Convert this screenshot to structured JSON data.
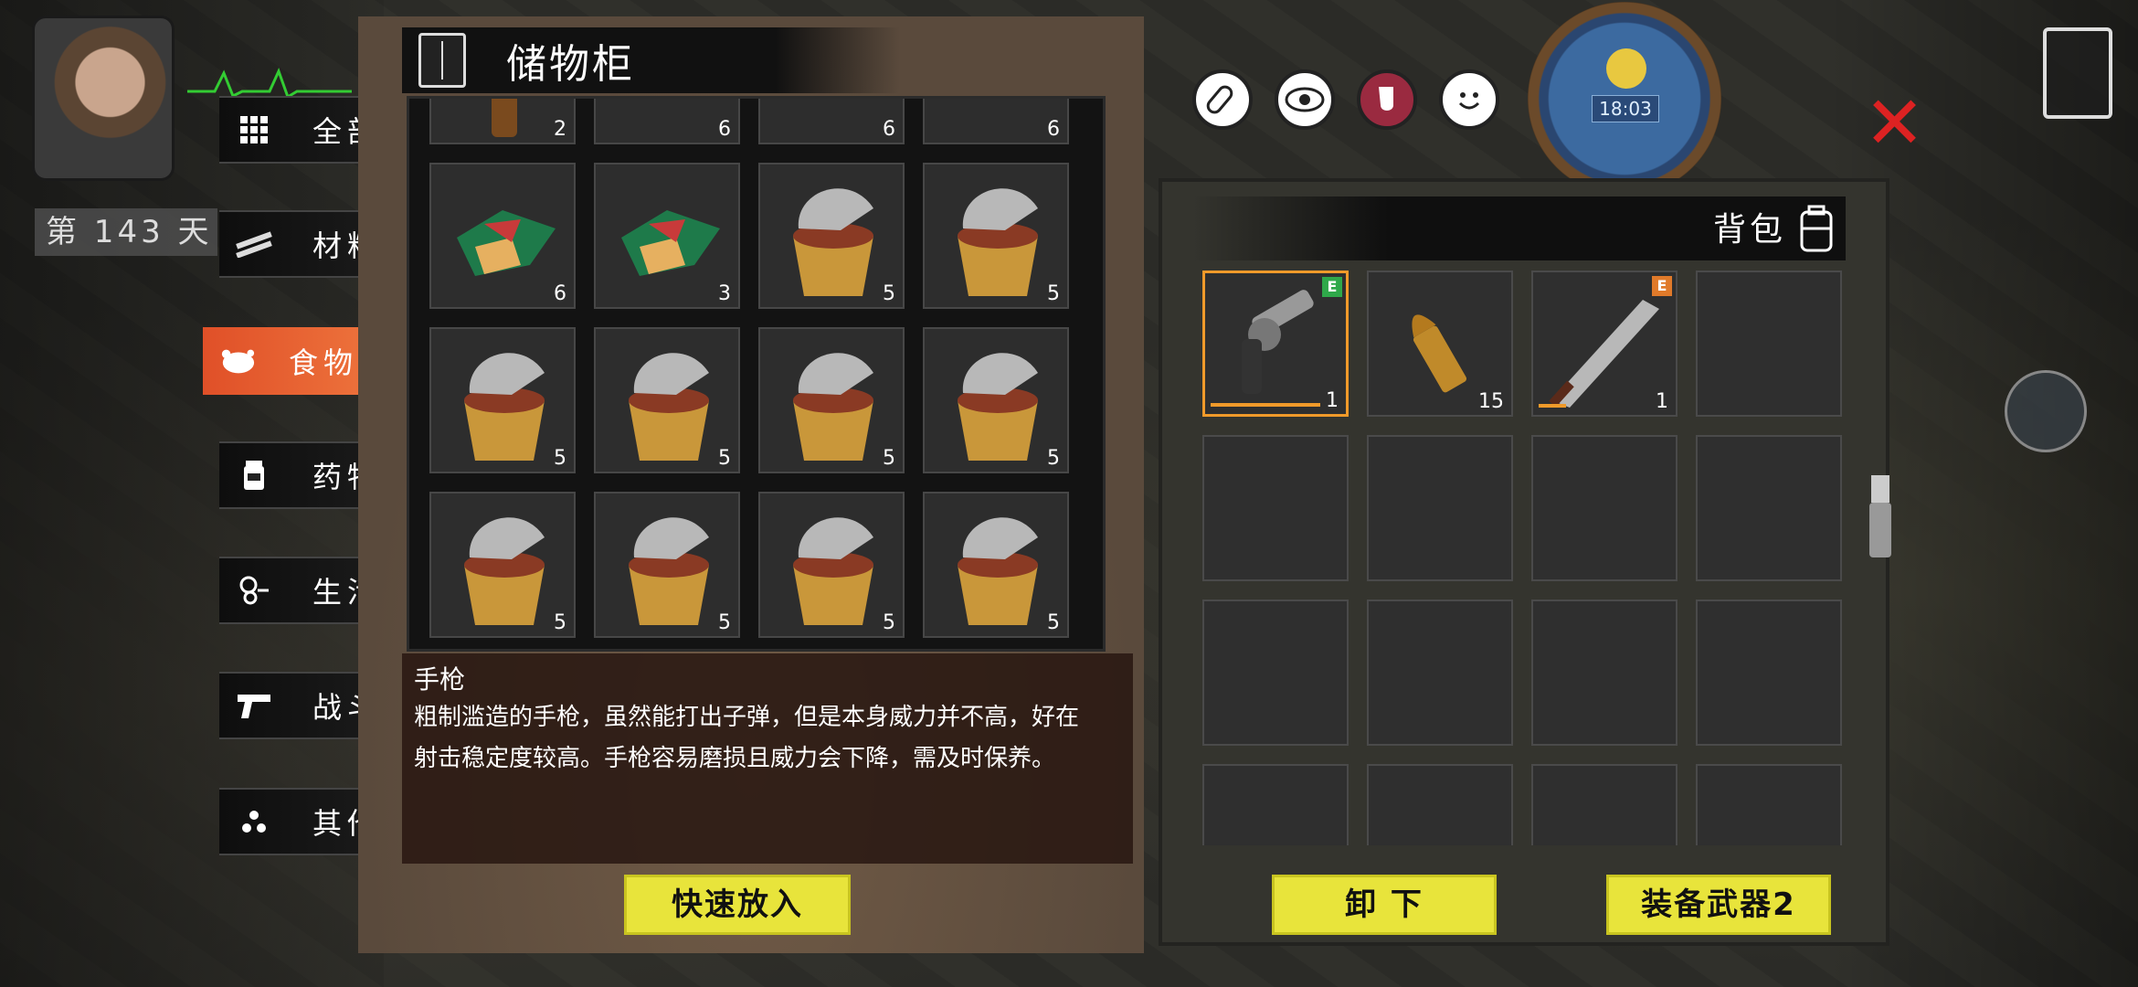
{
  "player": {
    "day_label": "第 143 天"
  },
  "categories": [
    {
      "label": "全部",
      "icon": "grid-icon"
    },
    {
      "label": "材料",
      "icon": "planks-icon"
    },
    {
      "label": "食物",
      "icon": "chicken-icon"
    },
    {
      "label": "药物",
      "icon": "medicine-icon"
    },
    {
      "label": "生活",
      "icon": "tools-icon"
    },
    {
      "label": "战斗",
      "icon": "pistol-icon"
    },
    {
      "label": "其他",
      "icon": "dots-icon"
    }
  ],
  "storage": {
    "title": "储物柜",
    "top_row_qty": [
      "2",
      "6",
      "6",
      "6"
    ],
    "rows": [
      [
        "6",
        "3",
        "5",
        "5"
      ],
      [
        "5",
        "5",
        "5",
        "5"
      ],
      [
        "5",
        "5",
        "5",
        "5"
      ]
    ],
    "item_title": "手枪",
    "item_desc": "粗制滥造的手枪，虽然能打出子弹，但是本身威力并不高，好在射击稳定度较高。手枪容易磨损且威力会下降，需及时保养。",
    "quick_put_button": "快速放入"
  },
  "backpack": {
    "title": "背包",
    "items": [
      {
        "name": "revolver-icon",
        "qty": "1",
        "badge": "E",
        "badge_color": "#2fa84a"
      },
      {
        "name": "bullet-icon",
        "qty": "15"
      },
      {
        "name": "machete-icon",
        "qty": "1",
        "badge": "E",
        "badge_color": "#e07a2a"
      }
    ],
    "unload_button": "卸 下",
    "equip_button": "装备武器2"
  },
  "clock": {
    "time": "18:03"
  },
  "colors": {
    "accent_orange": "#f07a40",
    "button_yellow": "#e8e43b",
    "close_red": "#d22222"
  }
}
